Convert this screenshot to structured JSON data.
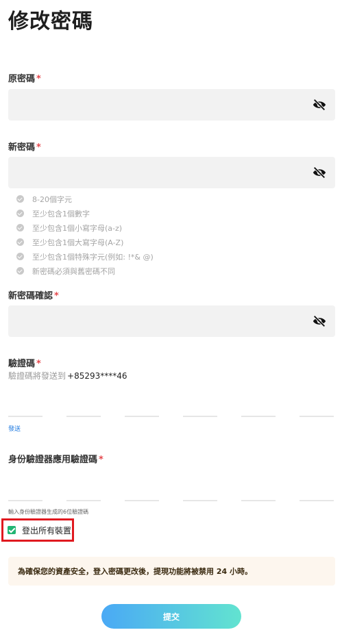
{
  "page": {
    "title": "修改密碼"
  },
  "old_password": {
    "label": "原密碼",
    "required_mark": "*",
    "value": "",
    "placeholder": ""
  },
  "new_password": {
    "label": "新密碼",
    "required_mark": "*",
    "value": "",
    "placeholder": "",
    "rules": [
      "8-20個字元",
      "至少包含1個數字",
      "至少包含1個小寫字母(a-z)",
      "至少包含1個大寫字母(A-Z)",
      "至少包含1個特殊字元(例如: !*& @)",
      "新密碼必須與舊密碼不同"
    ]
  },
  "confirm_password": {
    "label": "新密碼確認",
    "required_mark": "*",
    "value": "",
    "placeholder": ""
  },
  "verification": {
    "label": "驗證碼",
    "required_mark": "*",
    "hint_prefix": "驗證碼將發送到",
    "phone": "+85293****46",
    "send_label": "發送"
  },
  "authenticator": {
    "label": "身份驗證器應用驗證碼",
    "required_mark": "*",
    "hint": "輸入身份驗證器生成的6位驗證碼"
  },
  "logout_all": {
    "label": "登出所有裝置",
    "checked": true
  },
  "notice": {
    "text": "為確保您的資產安全，登入密碼更改後，提現功能將被禁用 24 小時。"
  },
  "submit": {
    "label": "提交"
  },
  "icons": {
    "eye": "eye-off-icon",
    "check": "check-icon"
  },
  "colors": {
    "required": "#e5484d",
    "link": "#1f7ae0",
    "checkbox": "#22b573",
    "highlight_border": "#e0191f",
    "notice_bg": "#fdf6ee",
    "button_start": "#4aa9f5",
    "button_end": "#62e3d0"
  }
}
